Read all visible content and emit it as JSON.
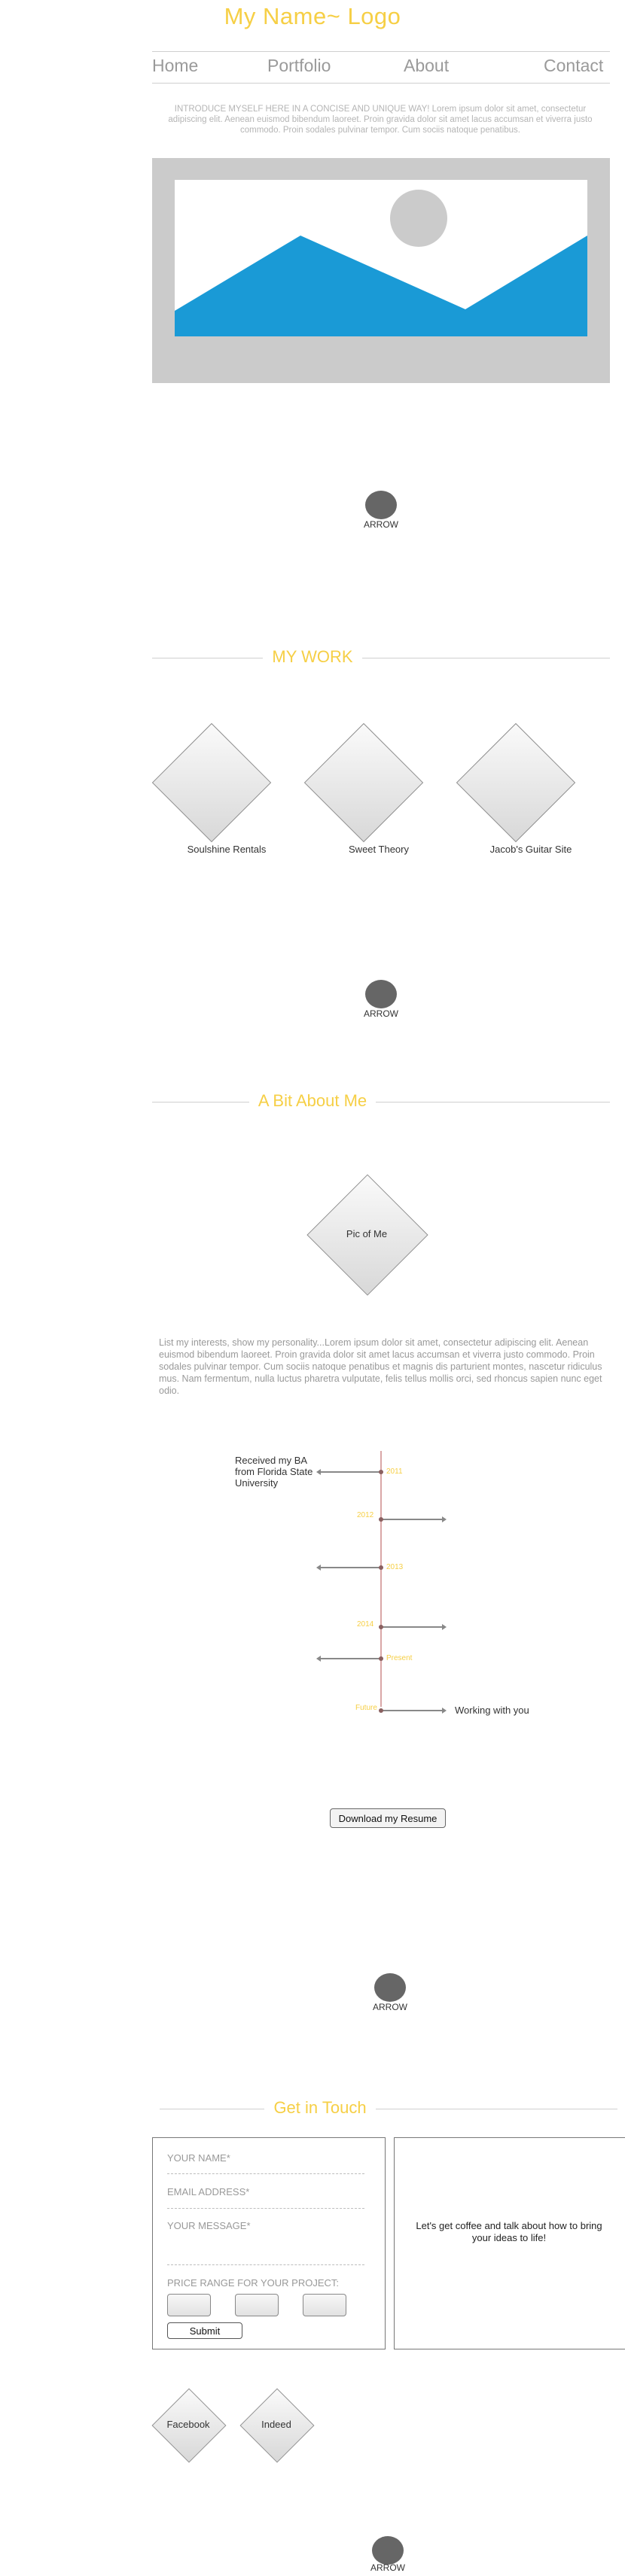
{
  "header": {
    "logo": "My Name~ Logo",
    "nav": [
      "Home",
      "Portfolio",
      "About",
      "Contact"
    ]
  },
  "intro": "INTRODUCE MYSELF HERE IN A CONCISE AND UNIQUE WAY! Lorem ipsum dolor sit amet, consectetur adipiscing elit. Aenean euismod bibendum laoreet. Proin gravida dolor sit amet lacus accumsan et viverra justo commodo. Proin sodales pulvinar tempor. Cum sociis natoque penatibus.",
  "arrows": [
    "ARROW",
    "ARROW",
    "ARROW",
    "ARROW"
  ],
  "work": {
    "title": "MY WORK",
    "items": [
      "Soulshine Rentals",
      "Sweet Theory",
      "Jacob's Guitar Site"
    ]
  },
  "about": {
    "title": "A Bit About Me",
    "pic_label": "Pic of Me",
    "text": "List my interests, show my personality...Lorem ipsum dolor sit amet, consectetur adipiscing elit. Aenean euismod bibendum laoreet. Proin gravida dolor sit amet lacus accumsan et viverra justo commodo. Proin sodales pulvinar tempor. Cum sociis natoque penatibus et magnis dis parturient montes, nascetur ridiculus mus. Nam fermentum, nulla luctus pharetra vulputate, felis tellus mollis orci, sed rhoncus sapien nunc eget odio."
  },
  "timeline": {
    "years": [
      "2011",
      "2012",
      "2013",
      "2014",
      "Present",
      "Future"
    ],
    "events": {
      "first": "Received my BA from Florida State University",
      "last": "Working with you"
    }
  },
  "resume_button": "Download my Resume",
  "contact": {
    "title": "Get in Touch",
    "name_label": "YOUR NAME*",
    "email_label": "EMAIL ADDRESS*",
    "message_label": "YOUR MESSAGE*",
    "range_label": "PRICE RANGE FOR YOUR PROJECT:",
    "submit": "Submit",
    "blurb": "Let's get coffee and talk about how to bring your ideas to life!"
  },
  "social": [
    "Facebook",
    "Indeed"
  ],
  "colors": {
    "accent": "#f6cf45",
    "hero_blue": "#1a9ad6",
    "hero_bg": "#cbcbcb"
  }
}
